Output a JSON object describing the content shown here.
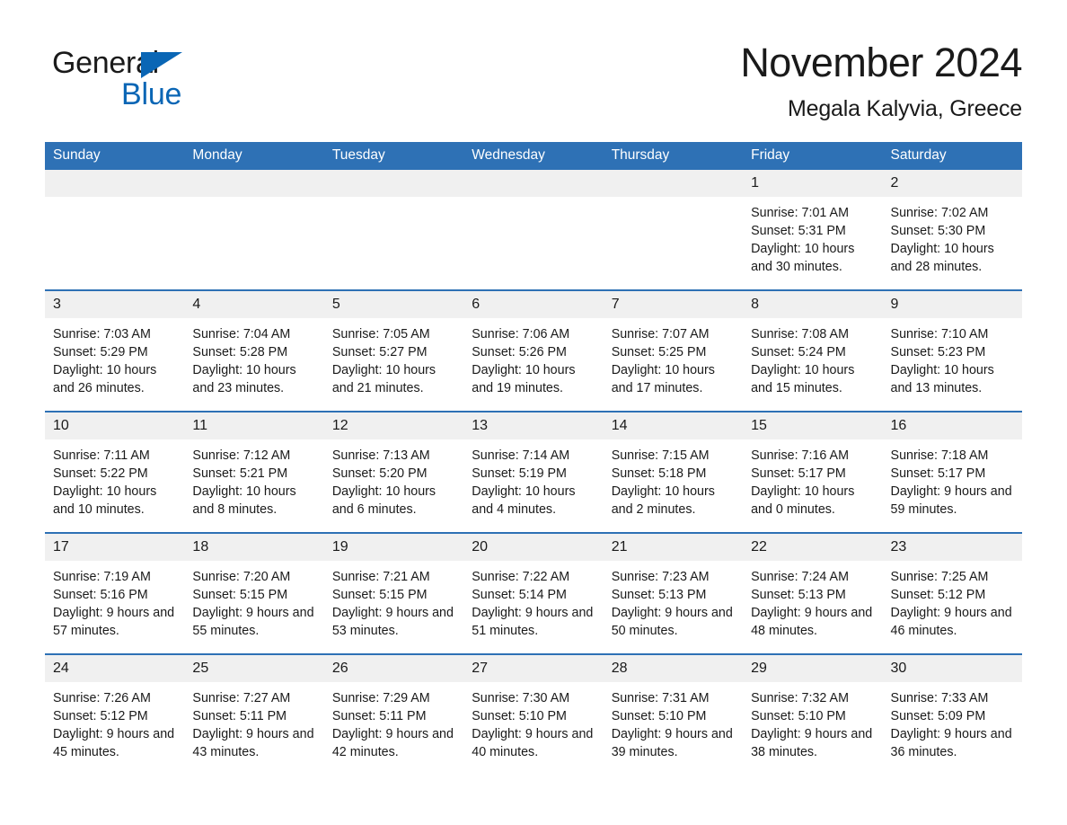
{
  "brand": {
    "name_part1": "General",
    "name_part2": "Blue",
    "accent_color": "#0a66b5"
  },
  "header": {
    "title": "November 2024",
    "subtitle": "Megala Kalyvia, Greece"
  },
  "theme": {
    "header_blue": "#2e71b5",
    "daynum_band": "#f0f0f0",
    "text": "#1a1a1a"
  },
  "weekdays": [
    "Sunday",
    "Monday",
    "Tuesday",
    "Wednesday",
    "Thursday",
    "Friday",
    "Saturday"
  ],
  "weeks": [
    [
      {
        "day": "",
        "sunrise": "",
        "sunset": "",
        "daylight": ""
      },
      {
        "day": "",
        "sunrise": "",
        "sunset": "",
        "daylight": ""
      },
      {
        "day": "",
        "sunrise": "",
        "sunset": "",
        "daylight": ""
      },
      {
        "day": "",
        "sunrise": "",
        "sunset": "",
        "daylight": ""
      },
      {
        "day": "",
        "sunrise": "",
        "sunset": "",
        "daylight": ""
      },
      {
        "day": "1",
        "sunrise": "Sunrise: 7:01 AM",
        "sunset": "Sunset: 5:31 PM",
        "daylight": "Daylight: 10 hours and 30 minutes."
      },
      {
        "day": "2",
        "sunrise": "Sunrise: 7:02 AM",
        "sunset": "Sunset: 5:30 PM",
        "daylight": "Daylight: 10 hours and 28 minutes."
      }
    ],
    [
      {
        "day": "3",
        "sunrise": "Sunrise: 7:03 AM",
        "sunset": "Sunset: 5:29 PM",
        "daylight": "Daylight: 10 hours and 26 minutes."
      },
      {
        "day": "4",
        "sunrise": "Sunrise: 7:04 AM",
        "sunset": "Sunset: 5:28 PM",
        "daylight": "Daylight: 10 hours and 23 minutes."
      },
      {
        "day": "5",
        "sunrise": "Sunrise: 7:05 AM",
        "sunset": "Sunset: 5:27 PM",
        "daylight": "Daylight: 10 hours and 21 minutes."
      },
      {
        "day": "6",
        "sunrise": "Sunrise: 7:06 AM",
        "sunset": "Sunset: 5:26 PM",
        "daylight": "Daylight: 10 hours and 19 minutes."
      },
      {
        "day": "7",
        "sunrise": "Sunrise: 7:07 AM",
        "sunset": "Sunset: 5:25 PM",
        "daylight": "Daylight: 10 hours and 17 minutes."
      },
      {
        "day": "8",
        "sunrise": "Sunrise: 7:08 AM",
        "sunset": "Sunset: 5:24 PM",
        "daylight": "Daylight: 10 hours and 15 minutes."
      },
      {
        "day": "9",
        "sunrise": "Sunrise: 7:10 AM",
        "sunset": "Sunset: 5:23 PM",
        "daylight": "Daylight: 10 hours and 13 minutes."
      }
    ],
    [
      {
        "day": "10",
        "sunrise": "Sunrise: 7:11 AM",
        "sunset": "Sunset: 5:22 PM",
        "daylight": "Daylight: 10 hours and 10 minutes."
      },
      {
        "day": "11",
        "sunrise": "Sunrise: 7:12 AM",
        "sunset": "Sunset: 5:21 PM",
        "daylight": "Daylight: 10 hours and 8 minutes."
      },
      {
        "day": "12",
        "sunrise": "Sunrise: 7:13 AM",
        "sunset": "Sunset: 5:20 PM",
        "daylight": "Daylight: 10 hours and 6 minutes."
      },
      {
        "day": "13",
        "sunrise": "Sunrise: 7:14 AM",
        "sunset": "Sunset: 5:19 PM",
        "daylight": "Daylight: 10 hours and 4 minutes."
      },
      {
        "day": "14",
        "sunrise": "Sunrise: 7:15 AM",
        "sunset": "Sunset: 5:18 PM",
        "daylight": "Daylight: 10 hours and 2 minutes."
      },
      {
        "day": "15",
        "sunrise": "Sunrise: 7:16 AM",
        "sunset": "Sunset: 5:17 PM",
        "daylight": "Daylight: 10 hours and 0 minutes."
      },
      {
        "day": "16",
        "sunrise": "Sunrise: 7:18 AM",
        "sunset": "Sunset: 5:17 PM",
        "daylight": "Daylight: 9 hours and 59 minutes."
      }
    ],
    [
      {
        "day": "17",
        "sunrise": "Sunrise: 7:19 AM",
        "sunset": "Sunset: 5:16 PM",
        "daylight": "Daylight: 9 hours and 57 minutes."
      },
      {
        "day": "18",
        "sunrise": "Sunrise: 7:20 AM",
        "sunset": "Sunset: 5:15 PM",
        "daylight": "Daylight: 9 hours and 55 minutes."
      },
      {
        "day": "19",
        "sunrise": "Sunrise: 7:21 AM",
        "sunset": "Sunset: 5:15 PM",
        "daylight": "Daylight: 9 hours and 53 minutes."
      },
      {
        "day": "20",
        "sunrise": "Sunrise: 7:22 AM",
        "sunset": "Sunset: 5:14 PM",
        "daylight": "Daylight: 9 hours and 51 minutes."
      },
      {
        "day": "21",
        "sunrise": "Sunrise: 7:23 AM",
        "sunset": "Sunset: 5:13 PM",
        "daylight": "Daylight: 9 hours and 50 minutes."
      },
      {
        "day": "22",
        "sunrise": "Sunrise: 7:24 AM",
        "sunset": "Sunset: 5:13 PM",
        "daylight": "Daylight: 9 hours and 48 minutes."
      },
      {
        "day": "23",
        "sunrise": "Sunrise: 7:25 AM",
        "sunset": "Sunset: 5:12 PM",
        "daylight": "Daylight: 9 hours and 46 minutes."
      }
    ],
    [
      {
        "day": "24",
        "sunrise": "Sunrise: 7:26 AM",
        "sunset": "Sunset: 5:12 PM",
        "daylight": "Daylight: 9 hours and 45 minutes."
      },
      {
        "day": "25",
        "sunrise": "Sunrise: 7:27 AM",
        "sunset": "Sunset: 5:11 PM",
        "daylight": "Daylight: 9 hours and 43 minutes."
      },
      {
        "day": "26",
        "sunrise": "Sunrise: 7:29 AM",
        "sunset": "Sunset: 5:11 PM",
        "daylight": "Daylight: 9 hours and 42 minutes."
      },
      {
        "day": "27",
        "sunrise": "Sunrise: 7:30 AM",
        "sunset": "Sunset: 5:10 PM",
        "daylight": "Daylight: 9 hours and 40 minutes."
      },
      {
        "day": "28",
        "sunrise": "Sunrise: 7:31 AM",
        "sunset": "Sunset: 5:10 PM",
        "daylight": "Daylight: 9 hours and 39 minutes."
      },
      {
        "day": "29",
        "sunrise": "Sunrise: 7:32 AM",
        "sunset": "Sunset: 5:10 PM",
        "daylight": "Daylight: 9 hours and 38 minutes."
      },
      {
        "day": "30",
        "sunrise": "Sunrise: 7:33 AM",
        "sunset": "Sunset: 5:09 PM",
        "daylight": "Daylight: 9 hours and 36 minutes."
      }
    ]
  ]
}
